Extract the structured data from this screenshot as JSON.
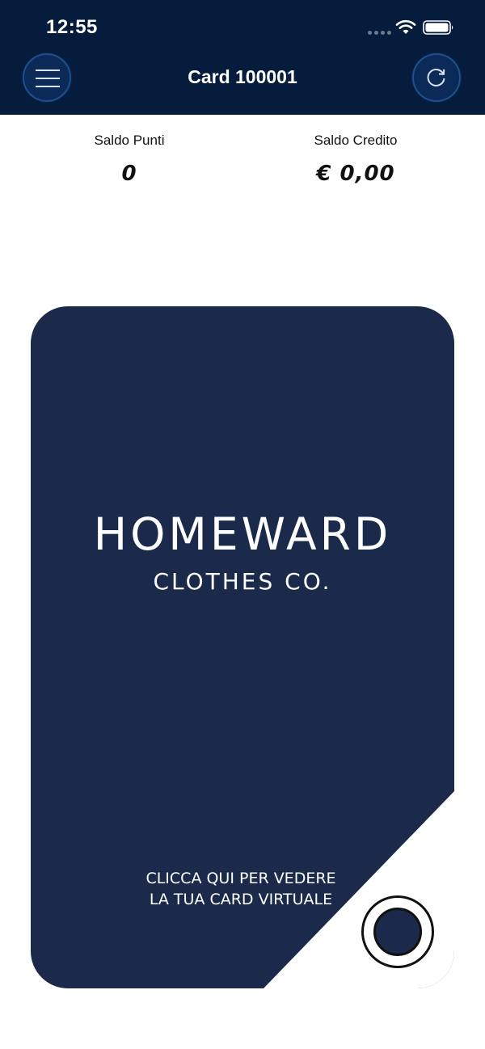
{
  "status_bar": {
    "time": "12:55",
    "signal_icon": "cellular-signal-icon",
    "wifi_icon": "wifi-icon",
    "battery_icon": "battery-icon"
  },
  "nav": {
    "title": "Card 100001",
    "menu_icon": "hamburger-menu-icon",
    "refresh_icon": "refresh-icon"
  },
  "balances": {
    "points_label": "Saldo Punti",
    "points_value": "0",
    "credit_label": "Saldo Credito",
    "credit_value": "€ 0,00"
  },
  "card": {
    "brand_name": "HOMEWARD",
    "brand_tagline": "CLOTHES CO.",
    "cta_line1": "CLICCA QUI PER VEDERE",
    "cta_line2": "LA TUA CARD VIRTUALE"
  },
  "colors": {
    "header_background": "#061c3d",
    "card_background": "#1b2a4a",
    "page_background": "#ffffff",
    "text_primary": "#111111"
  }
}
